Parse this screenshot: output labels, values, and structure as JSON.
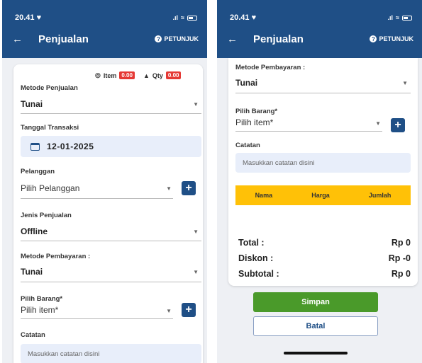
{
  "left": {
    "status": {
      "time": "20.41 ♥"
    },
    "header": {
      "title": "Penjualan",
      "help": "PETUNJUK"
    },
    "summary": {
      "item_label": "Item",
      "item_value": "0.00",
      "qty_label": "Qty",
      "qty_value": "0.00"
    },
    "sales_method": {
      "label": "Metode Penjualan",
      "value": "Tunai"
    },
    "transaction_date": {
      "label": "Tanggal Transaksi",
      "value": "12-01-2025"
    },
    "customer": {
      "label": "Pelanggan",
      "placeholder": "Pilih Pelanggan"
    },
    "sales_type": {
      "label": "Jenis Penjualan",
      "value": "Offline"
    },
    "payment_method": {
      "label": "Metode Pembayaran :",
      "value": "Tunai"
    },
    "item": {
      "label": "Pilih Barang*",
      "placeholder": "Pilih item*"
    },
    "notes": {
      "label": "Catatan",
      "placeholder": "Masukkan catatan disini"
    }
  },
  "right": {
    "status": {
      "time": "20.41 ♥"
    },
    "header": {
      "title": "Penjualan",
      "help": "PETUNJUK"
    },
    "payment_method": {
      "label": "Metode Pembayaran :",
      "value": "Tunai"
    },
    "item": {
      "label": "Pilih Barang*",
      "placeholder": "Pilih item*"
    },
    "notes": {
      "label": "Catatan",
      "placeholder": "Masukkan catatan disini"
    },
    "table": {
      "columns": [
        "Nama",
        "Harga",
        "Jumlah"
      ]
    },
    "totals": {
      "total_label": "Total :",
      "total_value": "Rp 0",
      "discount_label": "Diskon :",
      "discount_value": "Rp -0",
      "subtotal_label": "Subtotal :",
      "subtotal_value": "Rp 0"
    },
    "buttons": {
      "save": "Simpan",
      "cancel": "Batal"
    }
  },
  "colors": {
    "primary": "#1f4f86",
    "badge": "#e53935",
    "table_header": "#ffc107",
    "save": "#4a9a2a"
  },
  "icons": [
    "back-arrow-icon",
    "help-icon",
    "calendar-icon",
    "plus-icon",
    "dropdown-caret-icon",
    "wifi-icon",
    "signal-icon",
    "battery-icon"
  ]
}
